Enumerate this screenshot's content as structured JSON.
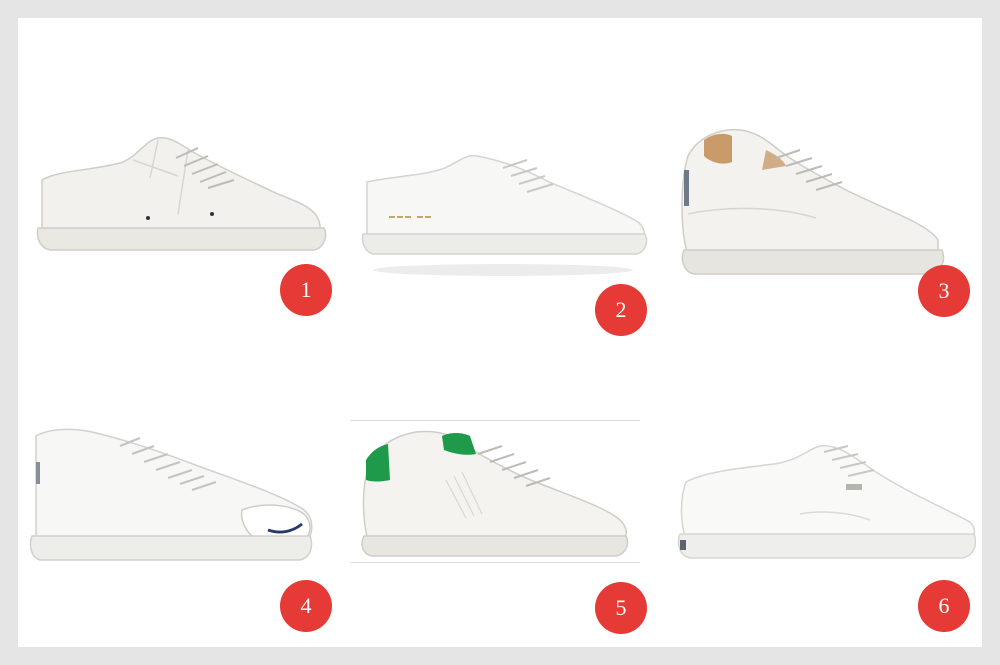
{
  "colors": {
    "page_background": "#e5e5e5",
    "board_background": "#ffffff",
    "badge_fill": "#e53a35",
    "badge_text": "#ffffff",
    "shoe_white": "#f4f4f2",
    "sole": "#e6e6e2",
    "outline": "#c8c8c4",
    "heel_tab_green": "#1f9a4a",
    "jack_purcell_smile": "#2a3b6b",
    "tan_lining": "#c99a6a"
  },
  "items": [
    {
      "number": "1",
      "icon": "white-leather-sneaker-icon"
    },
    {
      "number": "2",
      "icon": "minimal-white-sneaker-icon"
    },
    {
      "number": "3",
      "icon": "white-sneaker-tan-lining-icon"
    },
    {
      "number": "4",
      "icon": "white-canvas-sneaker-toe-cap-icon"
    },
    {
      "number": "5",
      "icon": "white-sneaker-green-heel-icon"
    },
    {
      "number": "6",
      "icon": "white-canvas-skate-sneaker-icon"
    }
  ]
}
